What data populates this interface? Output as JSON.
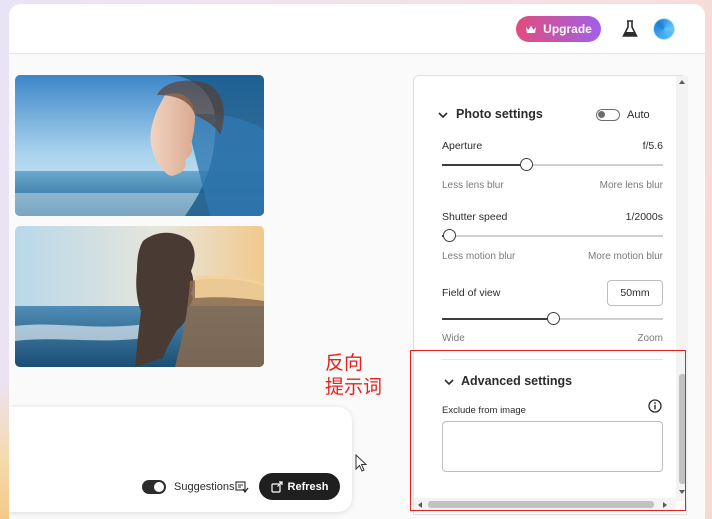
{
  "header": {
    "upgrade_label": "Upgrade"
  },
  "thumbnails": [
    {
      "alt": "double exposure portrait over sea, woman facing right"
    },
    {
      "alt": "double exposure portrait over sunset shore, woman facing right"
    }
  ],
  "prompt": {
    "suggestions_label": "Suggestions",
    "suggestions_on": true,
    "refresh_label": "Refresh"
  },
  "annotation": {
    "line1": "反向",
    "line2": "提示词"
  },
  "photo_settings": {
    "title": "Photo settings",
    "auto_label": "Auto",
    "auto_on": false,
    "aperture": {
      "label": "Aperture",
      "value": "f/5.6",
      "position": 0.38,
      "min_label": "Less lens blur",
      "max_label": "More lens blur"
    },
    "shutter": {
      "label": "Shutter speed",
      "value": "1/2000s",
      "position": 0.03,
      "min_label": "Less motion blur",
      "max_label": "More motion blur"
    },
    "fov": {
      "label": "Field of view",
      "value": "50mm",
      "position": 0.5,
      "min_label": "Wide",
      "max_label": "Zoom"
    }
  },
  "advanced_settings": {
    "title": "Advanced settings",
    "exclude_label": "Exclude from image",
    "exclude_value": ""
  },
  "colors": {
    "accent_start": "#e04d7d",
    "accent_end": "#a060e8",
    "annotation_red": "#e8201c",
    "dark_button": "#1f1f1f"
  }
}
